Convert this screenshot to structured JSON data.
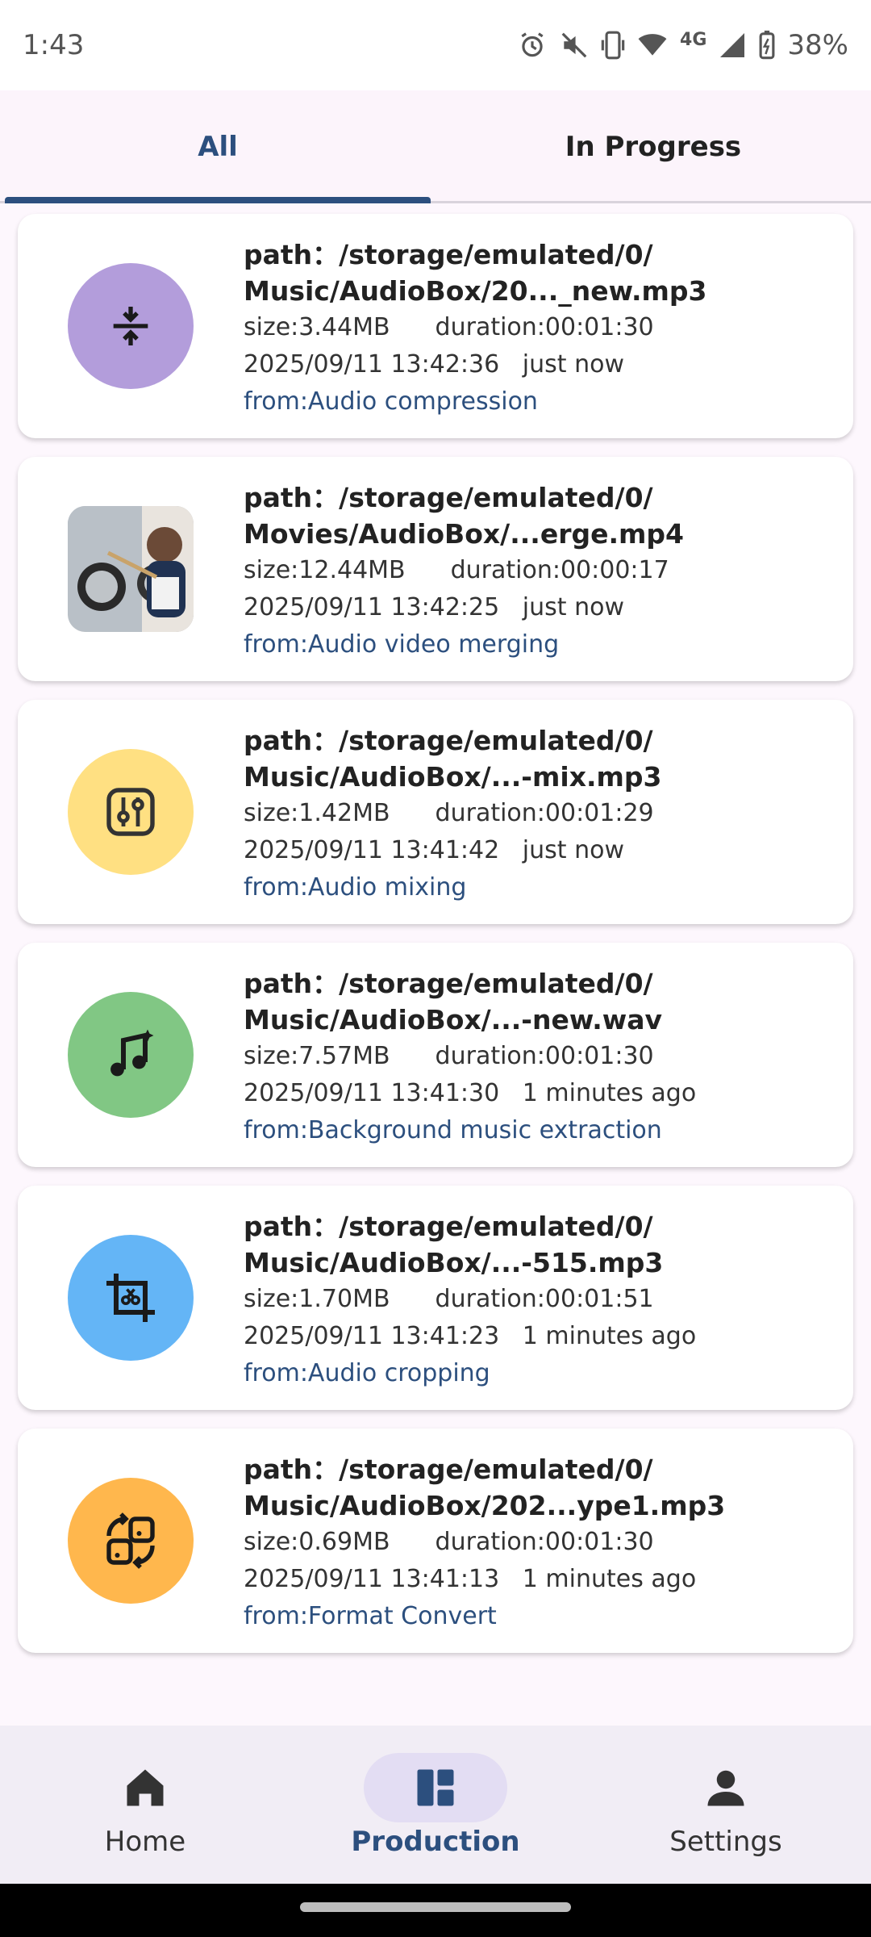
{
  "status_bar": {
    "time": "1:43",
    "battery": "38%",
    "network": "4G",
    "icons": [
      "alarm-icon",
      "mute-icon",
      "vibrate-icon",
      "wifi-icon",
      "signal-icon",
      "battery-icon"
    ]
  },
  "tabs": [
    {
      "label": "All",
      "active": true
    },
    {
      "label": "In Progress",
      "active": false
    }
  ],
  "items": [
    {
      "path_line1": "path：/storage/emulated/0/",
      "path_line2": "Music/AudioBox/20..._new.mp3",
      "size": "size:3.44MB",
      "duration": "duration:00:01:30",
      "date": "2025/09/11 13:42:36",
      "relative": "just now",
      "from": "from:Audio compression",
      "icon": "compress-icon",
      "color": "#B39DDB"
    },
    {
      "path_line1": "path：/storage/emulated/0/",
      "path_line2": "Movies/AudioBox/...erge.mp4",
      "size": "size:12.44MB",
      "duration": "duration:00:00:17",
      "date": "2025/09/11 13:42:25",
      "relative": "just now",
      "from": "from:Audio video merging",
      "icon": "video-thumbnail",
      "color": "#9BA7B3"
    },
    {
      "path_line1": "path：/storage/emulated/0/",
      "path_line2": "Music/AudioBox/...-mix.mp3",
      "size": "size:1.42MB",
      "duration": "duration:00:01:29",
      "date": "2025/09/11 13:41:42",
      "relative": "just now",
      "from": "from:Audio mixing",
      "icon": "mixer-icon",
      "color": "#FFE082"
    },
    {
      "path_line1": "path：/storage/emulated/0/",
      "path_line2": "Music/AudioBox/...-new.wav",
      "size": "size:7.57MB",
      "duration": "duration:00:01:30",
      "date": "2025/09/11 13:41:30",
      "relative": "1 minutes ago",
      "from": "from:Background music extraction",
      "icon": "music-note-icon",
      "color": "#81C784"
    },
    {
      "path_line1": "path：/storage/emulated/0/",
      "path_line2": "Music/AudioBox/...-515.mp3",
      "size": "size:1.70MB",
      "duration": "duration:00:01:51",
      "date": "2025/09/11 13:41:23",
      "relative": "1 minutes ago",
      "from": "from:Audio cropping",
      "icon": "crop-icon",
      "color": "#64B5F6"
    },
    {
      "path_line1": "path：/storage/emulated/0/",
      "path_line2": "Music/AudioBox/202...ype1.mp3",
      "size": "size:0.69MB",
      "duration": "duration:00:01:30",
      "date": "2025/09/11 13:41:13",
      "relative": "1 minutes ago",
      "from": "from:Format Convert",
      "icon": "convert-icon",
      "color": "#FFB74D"
    }
  ],
  "bottom_nav": [
    {
      "label": "Home",
      "icon": "home-icon",
      "active": false
    },
    {
      "label": "Production",
      "icon": "dashboard-icon",
      "active": true
    },
    {
      "label": "Settings",
      "icon": "person-icon",
      "active": false
    }
  ],
  "colors": {
    "accent": "#2C4F7E",
    "background": "#FDF7FD",
    "card": "#FFFFFF"
  }
}
